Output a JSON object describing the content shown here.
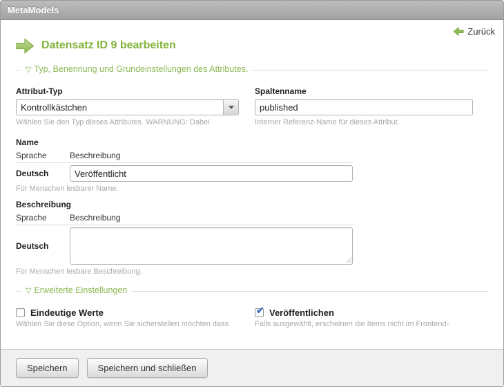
{
  "window": {
    "title": "MetaModels",
    "back_link_label": "Zurück"
  },
  "page": {
    "heading": "Datensatz ID 9 bearbeiten"
  },
  "icons": {
    "collapse_glyph": "▽"
  },
  "colors": {
    "accent_green": "#8ab954",
    "check_blue": "#3a70c0",
    "helper_gray": "#a8a8a8"
  },
  "sections": {
    "basic": {
      "legend": "Typ, Benennung und Grundeinstellungen des Attributes.",
      "attribute_type": {
        "label": "Attribut-Typ",
        "value": "Kontrollkästchen",
        "help": "Wählen Sie den Typ dieses Attributes. WARNUNG: Dabei"
      },
      "column_name": {
        "label": "Spaltenname",
        "value": "published",
        "help": "Interner Referenz-Name für dieses Attribut."
      },
      "name": {
        "label": "Name",
        "col_language": "Sprache",
        "col_value": "Beschreibung",
        "row_language": "Deutsch",
        "value": "Veröffentlicht",
        "help": "Für Menschen lesbarer Name."
      },
      "description": {
        "label": "Beschreibung",
        "col_language": "Sprache",
        "col_value": "Beschreibung",
        "row_language": "Deutsch",
        "value": "",
        "help": "Für Menschen lesbare Beschreibung."
      }
    },
    "advanced": {
      "legend": "Erweiterte Einstellungen",
      "unique": {
        "label": "Eindeutige Werte",
        "checked": false,
        "help": "Wählen Sie diese Option, wenn Sie sicherstellen möchten dass"
      },
      "published": {
        "label": "Veröffentlichen",
        "checked": true,
        "help": "Falls ausgewählt, erscheinen die Items nicht im Frontend-"
      }
    }
  },
  "footer": {
    "save_label": "Speichern",
    "save_close_label": "Speichern und schließen"
  }
}
